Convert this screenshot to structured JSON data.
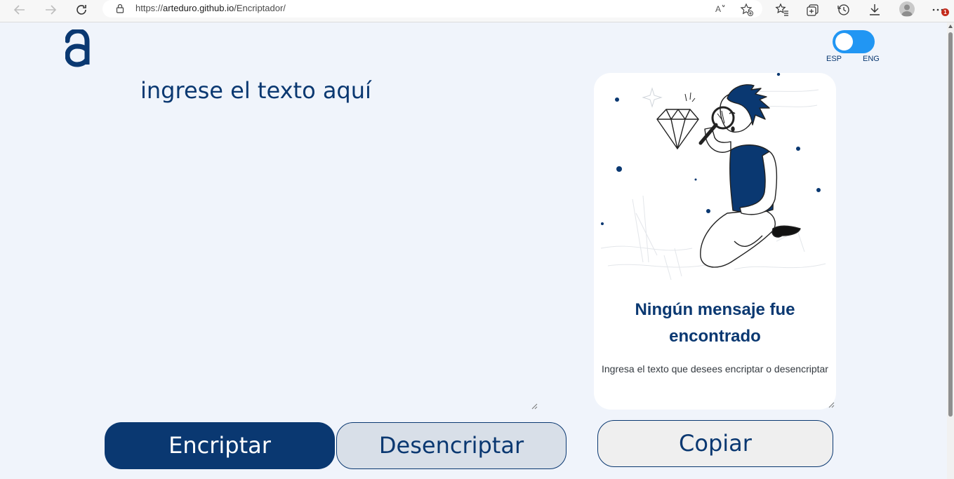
{
  "browser": {
    "url_prefix": "https://",
    "url_host": "arteduro.github.io",
    "url_path": "/Encriptador/",
    "notification_count": "1"
  },
  "language_toggle": {
    "left_label": "ESP",
    "right_label": "ENG"
  },
  "input": {
    "placeholder": "ingrese el texto aquí"
  },
  "result_card": {
    "title_line1": "Ningún mensaje fue",
    "title_line2": "encontrado",
    "description": "Ingresa el texto que desees encriptar o desencriptar"
  },
  "buttons": {
    "encrypt": "Encriptar",
    "decrypt": "Desencriptar",
    "copy": "Copiar"
  },
  "colors": {
    "primary": "#0a3871",
    "background": "#f0f4fb",
    "toggle": "#2196f3"
  }
}
